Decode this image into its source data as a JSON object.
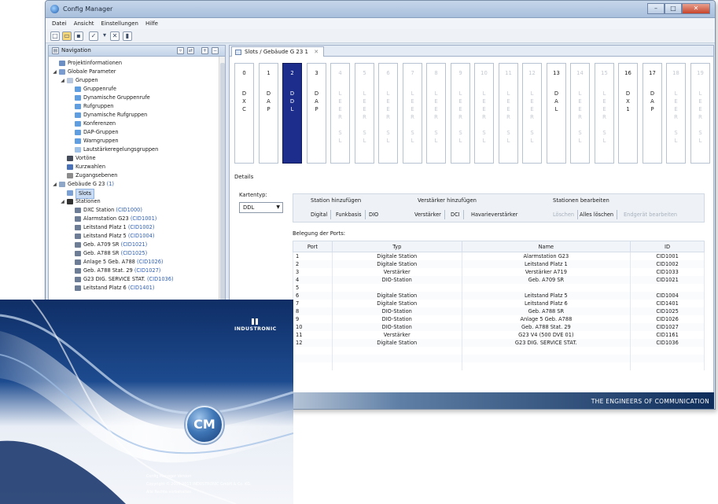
{
  "window": {
    "title": "Config Manager",
    "controls": [
      "–",
      "□",
      "✕"
    ]
  },
  "menubar": [
    "Datei",
    "Ansicht",
    "Einstellungen",
    "Hilfe"
  ],
  "navigation": {
    "title": "Navigation",
    "tree": [
      {
        "label": "Projektinformationen",
        "code": "",
        "indent": 0
      },
      {
        "label": "Globale Parameter",
        "code": "",
        "indent": 0
      },
      {
        "label": "Gruppen",
        "code": "",
        "indent": 1
      },
      {
        "label": "Gruppenrufe",
        "code": "",
        "indent": 2
      },
      {
        "label": "Dynamische Gruppenrufe",
        "code": "",
        "indent": 2
      },
      {
        "label": "Rufgruppen",
        "code": "",
        "indent": 2
      },
      {
        "label": "Dynamische Rufgruppen",
        "code": "",
        "indent": 2
      },
      {
        "label": "Konferenzen",
        "code": "",
        "indent": 2
      },
      {
        "label": "DAP-Gruppen",
        "code": "",
        "indent": 2
      },
      {
        "label": "Warngruppen",
        "code": "",
        "indent": 2
      },
      {
        "label": "Lautstärkeregelungsgruppen",
        "code": "",
        "indent": 2
      },
      {
        "label": "Vortöne",
        "code": "",
        "indent": 1
      },
      {
        "label": "Kurzwahlen",
        "code": "",
        "indent": 1
      },
      {
        "label": "Zugangsebenen",
        "code": "",
        "indent": 1
      },
      {
        "label": "Gebäude G 23",
        "code": "(1)",
        "indent": 0
      },
      {
        "label": "Slots",
        "code": "",
        "indent": 1
      },
      {
        "label": "Stationen",
        "code": "",
        "indent": 1
      },
      {
        "label": "DXC Station",
        "code": "(CID1000)",
        "indent": 2
      },
      {
        "label": "Alarmstation G23",
        "code": "(CID1001)",
        "indent": 2
      },
      {
        "label": "Leitstand Platz 1",
        "code": "(CID1002)",
        "indent": 2
      },
      {
        "label": "Leitstand Platz 5",
        "code": "(CID1004)",
        "indent": 2
      },
      {
        "label": "Geb. A709 SR",
        "code": "(CID1021)",
        "indent": 2
      },
      {
        "label": "Geb. A788 SR",
        "code": "(CID1025)",
        "indent": 2
      },
      {
        "label": "Anlage 5 Geb. A788",
        "code": "(CID1026)",
        "indent": 2
      },
      {
        "label": "Geb. A788 Stat. 29",
        "code": "(CID1027)",
        "indent": 2
      },
      {
        "label": "G23 DIG. SERVICE STAT.",
        "code": "(CID1036)",
        "indent": 2
      },
      {
        "label": "Leitstand Platz 6",
        "code": "(CID1401)",
        "indent": 2
      }
    ]
  },
  "editor": {
    "tab_label": "Slots / Gebäude G 23 1",
    "slots": [
      {
        "num": "0",
        "letters": [
          "D",
          "X",
          "C"
        ],
        "empty": false
      },
      {
        "num": "1",
        "letters": [
          "D",
          "A",
          "P"
        ],
        "empty": false
      },
      {
        "num": "2",
        "letters": [
          "D",
          "D",
          "L"
        ],
        "empty": false,
        "active": true
      },
      {
        "num": "3",
        "letters": [
          "D",
          "A",
          "P"
        ],
        "empty": false
      },
      {
        "num": "4",
        "letters": [
          "L",
          "E",
          "E",
          "R",
          "",
          "S",
          "L"
        ],
        "empty": true
      },
      {
        "num": "5",
        "letters": [
          "L",
          "E",
          "E",
          "R",
          "",
          "S",
          "L"
        ],
        "empty": true
      },
      {
        "num": "6",
        "letters": [
          "L",
          "E",
          "E",
          "R",
          "",
          "S",
          "L"
        ],
        "empty": true
      },
      {
        "num": "7",
        "letters": [
          "L",
          "E",
          "E",
          "R",
          "",
          "S",
          "L"
        ],
        "empty": true
      },
      {
        "num": "8",
        "letters": [
          "L",
          "E",
          "E",
          "R",
          "",
          "S",
          "L"
        ],
        "empty": true
      },
      {
        "num": "9",
        "letters": [
          "L",
          "E",
          "E",
          "R",
          "",
          "S",
          "L"
        ],
        "empty": true
      },
      {
        "num": "10",
        "letters": [
          "L",
          "E",
          "E",
          "R",
          "",
          "S",
          "L"
        ],
        "empty": true
      },
      {
        "num": "11",
        "letters": [
          "L",
          "E",
          "E",
          "R",
          "",
          "S",
          "L"
        ],
        "empty": true
      },
      {
        "num": "12",
        "letters": [
          "L",
          "E",
          "E",
          "R",
          "",
          "S",
          "L"
        ],
        "empty": true
      },
      {
        "num": "13",
        "letters": [
          "D",
          "A",
          "L"
        ],
        "empty": false
      },
      {
        "num": "14",
        "letters": [
          "L",
          "E",
          "E",
          "R",
          "",
          "S",
          "L"
        ],
        "empty": true
      },
      {
        "num": "15",
        "letters": [
          "L",
          "E",
          "E",
          "R",
          "",
          "S",
          "L"
        ],
        "empty": true
      },
      {
        "num": "16",
        "letters": [
          "D",
          "X",
          "1"
        ],
        "empty": false
      },
      {
        "num": "17",
        "letters": [
          "D",
          "A",
          "P"
        ],
        "empty": false
      },
      {
        "num": "18",
        "letters": [
          "L",
          "E",
          "E",
          "R",
          "",
          "S",
          "L"
        ],
        "empty": true
      },
      {
        "num": "19",
        "letters": [
          "L",
          "E",
          "E",
          "R",
          "",
          "S",
          "L"
        ],
        "empty": true
      }
    ],
    "details": {
      "title": "Details",
      "kartentyp_label": "Kartentyp:",
      "kartentyp_value": "DDL",
      "groups": {
        "station_title": "Station hinzufügen",
        "station_buttons": [
          "Digital",
          "Funkbasis",
          "DIO"
        ],
        "verstaerker_title": "Verstärker hinzufügen",
        "verstaerker_buttons": [
          "Verstärker",
          "DCI",
          "Havarieverstärker"
        ],
        "bearbeiten_title": "Stationen bearbeiten",
        "bearbeiten_buttons": [
          "Löschen",
          "Alles löschen",
          "Endgerät bearbeiten"
        ]
      },
      "ports_title": "Belegung der Ports:",
      "columns": [
        "Port",
        "Typ",
        "Name",
        "ID"
      ],
      "rows": [
        [
          "1",
          "Digitale Station",
          "Alarmstation G23",
          "CID1001"
        ],
        [
          "2",
          "Digitale Station",
          "Leitstand Platz 1",
          "CID1002"
        ],
        [
          "3",
          "Verstärker",
          "Verstärker A719",
          "CID1033"
        ],
        [
          "4",
          "DIO-Station",
          "Geb. A709 SR",
          "CID1021"
        ],
        [
          "5",
          "",
          "",
          ""
        ],
        [
          "6",
          "Digitale Station",
          "Leitstand Platz 5",
          "CID1004"
        ],
        [
          "7",
          "Digitale Station",
          "Leitstand Platz 6",
          "CID1401"
        ],
        [
          "8",
          "DIO-Station",
          "Geb. A788 SR",
          "CID1025"
        ],
        [
          "9",
          "DIO-Station",
          "Anlage 5 Geb. A788",
          "CID1026"
        ],
        [
          "10",
          "DIO-Station",
          "Geb. A788 Stat. 29",
          "CID1027"
        ],
        [
          "11",
          "Verstärker",
          "G23 V4 (500 DVE 01)",
          "CID1161"
        ],
        [
          "12",
          "Digitale Station",
          "G23 DIG. SERVICE STAT.",
          "CID1036"
        ]
      ]
    }
  },
  "footer_text": "THE ENGINEERS OF COMMUNICATION",
  "splash": {
    "logo": "INDUSTRONIC",
    "badge": "CM",
    "version": "Config Manager Version",
    "copyright": "Copyright © 2009-2013 INDUSTRONIC GmbH & Co. KG.",
    "rights": "Alle Rechte vorbehalten."
  },
  "colors": {
    "active_slot": "#1d2d8c",
    "link_code": "#2f5fb5",
    "footer_dark": "#0f2d5a"
  }
}
